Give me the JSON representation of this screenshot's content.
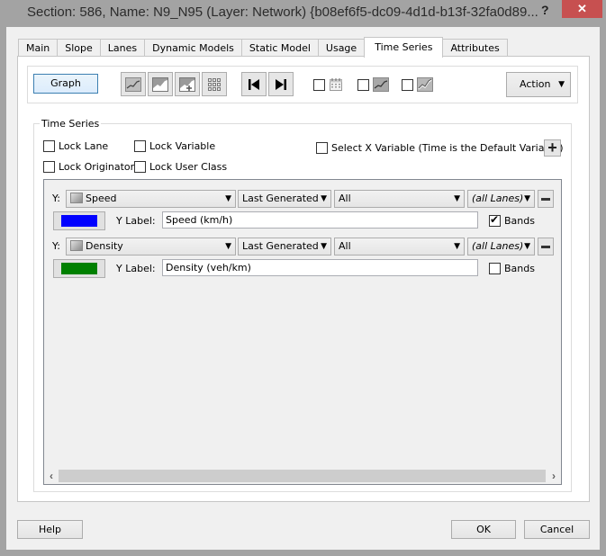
{
  "window": {
    "title": "Section: 586, Name: N9_N95 (Layer: Network) {b08ef6f5-dc09-4d1d-b13f-32fa0d89...",
    "help_glyph": "?",
    "close_glyph": "✕"
  },
  "tabs": [
    {
      "label": "Main",
      "active": false
    },
    {
      "label": "Slope",
      "active": false
    },
    {
      "label": "Lanes",
      "active": false
    },
    {
      "label": "Dynamic Models",
      "active": false
    },
    {
      "label": "Static Model",
      "active": false
    },
    {
      "label": "Usage",
      "active": false
    },
    {
      "label": "Time Series",
      "active": true
    },
    {
      "label": "Attributes",
      "active": false
    }
  ],
  "toolbar": {
    "graph_label": "Graph",
    "icons": [
      "line-chart-icon",
      "area-chart-icon",
      "area-chart-add-icon",
      "grid-icon",
      "first-icon",
      "last-icon"
    ],
    "first_glyph": "⏮",
    "last_glyph": "⏭",
    "toggles": [
      {
        "icon": "calendar-icon",
        "checked": false
      },
      {
        "icon": "line-chart-icon",
        "checked": false
      },
      {
        "icon": "line-chart-color-icon",
        "checked": false
      }
    ],
    "action_label": "Action",
    "dropdown_glyph": "▼"
  },
  "time_series": {
    "group_title": "Time Series",
    "lock_lane": "Lock Lane",
    "lock_variable": "Lock Variable",
    "lock_originator": "Lock Originator",
    "lock_user_class": "Lock User Class",
    "select_x": "Select X Variable (Time is the Default Variable)",
    "add_glyph": "+",
    "series": [
      {
        "y_prefix": "Y:",
        "variable": "Speed",
        "source": "Last Generated",
        "scope": "All",
        "lanes": "(all Lanes)",
        "color": "#0000ff",
        "y_label_caption": "Y Label:",
        "y_label_value": "Speed (km/h)",
        "bands_label": "Bands",
        "bands_checked": true
      },
      {
        "y_prefix": "Y:",
        "variable": "Density",
        "source": "Last Generated",
        "scope": "All",
        "lanes": "(all Lanes)",
        "color": "#008000",
        "y_label_caption": "Y Label:",
        "y_label_value": "Density (veh/km)",
        "bands_label": "Bands",
        "bands_checked": false
      }
    ],
    "scroll_left": "‹",
    "scroll_right": "›"
  },
  "footer": {
    "help": "Help",
    "ok": "OK",
    "cancel": "Cancel"
  }
}
